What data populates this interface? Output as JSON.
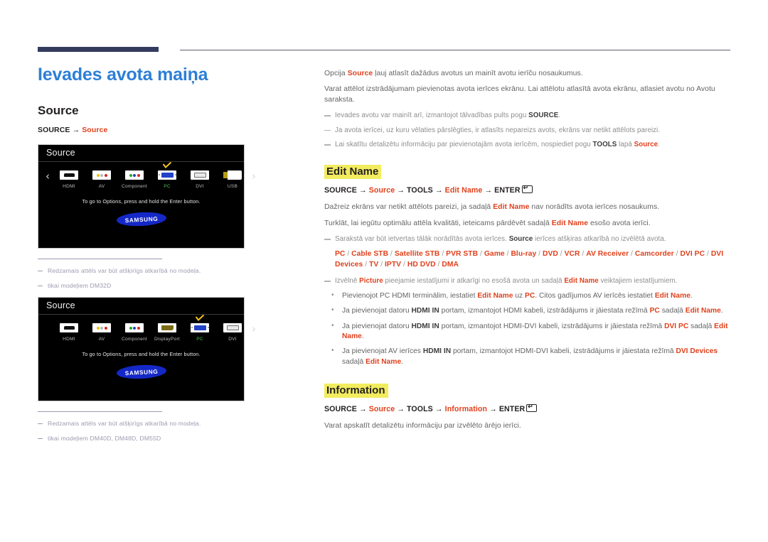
{
  "document": {
    "page_title": "Ievades avota maiņa",
    "accent_color": "#e0401c",
    "title_color": "#2d7fd6",
    "highlight_color": "#f2ec5e",
    "rule_color": "#333b5e"
  },
  "left": {
    "section_title": "Source",
    "path": {
      "source": "SOURCE",
      "arrow": "→",
      "target": "Source"
    },
    "panels": [
      {
        "header": "Source",
        "prev_arrow": "‹",
        "next_arrow": "›",
        "hint": "To go to Options, press and hold the Enter button.",
        "brand": "SAMSUNG",
        "items": [
          {
            "label": "HDMI",
            "icon": "hdmi-port-icon",
            "selected": false
          },
          {
            "label": "AV",
            "icon": "av-rca-icon",
            "selected": false
          },
          {
            "label": "Component",
            "icon": "component-rca-icon",
            "selected": false
          },
          {
            "label": "PC",
            "icon": "dsub-vga-icon",
            "selected": true
          },
          {
            "label": "DVI",
            "icon": "dvi-port-icon",
            "selected": false
          },
          {
            "label": "USB",
            "icon": "usb-stick-icon",
            "selected": false
          }
        ],
        "footnotes": [
          "Redzamais attēls var būt atšķirīgs atkarībā no modeļa.",
          "tikai modeļiem DM32D"
        ]
      },
      {
        "header": "Source",
        "prev_arrow": "",
        "next_arrow": "›",
        "hint": "To go to Options, press and hold the Enter button.",
        "brand": "SAMSUNG",
        "items": [
          {
            "label": "HDMI",
            "icon": "hdmi-port-icon",
            "selected": false
          },
          {
            "label": "AV",
            "icon": "av-rca-icon",
            "selected": false
          },
          {
            "label": "Component",
            "icon": "component-rca-icon",
            "selected": false
          },
          {
            "label": "DisplayPort",
            "icon": "displayport-icon",
            "selected": false
          },
          {
            "label": "PC",
            "icon": "dsub-vga-icon",
            "selected": true
          },
          {
            "label": "DVI",
            "icon": "dvi-port-icon",
            "selected": false
          }
        ],
        "footnotes": [
          "Redzamais attēls var būt atšķirīgs atkarībā no modeļa.",
          "tikai modeļiem DM40D, DM48D, DM55D"
        ]
      }
    ]
  },
  "right": {
    "intro": {
      "p1_a": "Opcija ",
      "p1_source": "Source",
      "p1_b": " ļauj atlasīt dažādus avotus un mainīt avotu ierīču nosaukumus.",
      "p2": "Varat attēlot izstrādājumam pievienotas avota ierīces ekrānu. Lai attēlotu atlasītā avota ekrānu, atlasiet avotu no Avotu saraksta.",
      "note1_a": "Ievades avotu var mainīt arī, izmantojot tālvadības pults pogu ",
      "note1_b": "SOURCE",
      "note1_c": ".",
      "note2": "Ja avota ierīcei, uz kuru vēlaties pārslēgties, ir atlasīts nepareizs avots, ekrāns var netikt attēlots pareizi.",
      "note3_a": "Lai skatītu detalizētu informāciju par pievienotajām avota ierīcēm, nospiediet pogu ",
      "note3_b": "TOOLS",
      "note3_c": " lapā ",
      "note3_d": "Source",
      "note3_e": "."
    },
    "edit_name": {
      "heading": "Edit Name",
      "path": {
        "p1": "SOURCE",
        "p2": "Source",
        "p3": "TOOLS",
        "p4": "Edit Name",
        "p5": "ENTER",
        "arrow": "→"
      },
      "p1_a": "Dažreiz ekrāns var netikt attēlots pareizi, ja sadaļā ",
      "p1_b": "Edit Name",
      "p1_c": " nav norādīts avota ierīces nosaukums.",
      "p2_a": "Turklāt, lai iegūtu optimālu attēla kvalitāti, ieteicams pārdēvēt sadaļā ",
      "p2_b": "Edit Name",
      "p2_c": " esošo avota ierīci.",
      "note_list_a": "Sarakstā var būt ietvertas tālāk norādītās avota ierīces. ",
      "note_list_b": "Source",
      "note_list_c": " ierīces atšķiras atkarībā no izvēlētā avota.",
      "device_list": [
        "PC",
        "Cable STB",
        "Satellite STB",
        "PVR STB",
        "Game",
        "Blu-ray",
        "DVD",
        "VCR",
        "AV Receiver",
        "Camcorder",
        "DVI PC",
        "DVI Devices",
        "TV",
        "IPTV",
        "HD DVD",
        "DMA"
      ],
      "note_picture_a": "Izvēlnē ",
      "note_picture_b": "Picture",
      "note_picture_c": " pieejamie iestatījumi ir atkarīgi no esošā avota un sadaļā ",
      "note_picture_d": "Edit Name",
      "note_picture_e": " veiktajiem iestatījumiem.",
      "bullets": [
        {
          "t1": "Pievienojot PC HDMI terminālim, iestatiet ",
          "b1": "Edit Name",
          "t2": " uz ",
          "b2": "PC",
          "t3": ". Citos gadījumos AV ierīcēs iestatiet ",
          "b3": "Edit Name",
          "t4": "."
        },
        {
          "t1": "Ja pievienojat datoru ",
          "b1": "HDMI IN",
          "t2": " portam, izmantojot HDMI kabeli, izstrādājums ir jāiestata režīmā ",
          "b2": "PC",
          "t3": " sadaļā ",
          "b3": "Edit Name",
          "t4": "."
        },
        {
          "t1": "Ja pievienojat datoru ",
          "b1": "HDMI IN",
          "t2": "  portam, izmantojot HDMI-DVI kabeli, izstrādājums ir jāiestata režīmā ",
          "b2": "DVI PC",
          "t3": " sadaļā ",
          "b3": "Edit Name",
          "t4": "."
        },
        {
          "t1": "Ja pievienojat AV ierīces ",
          "b1": "HDMI IN",
          "t2": "  portam, izmantojot HDMI-DVI kabeli, izstrādājums ir jāiestata režīmā ",
          "b2": "DVI Devices",
          "t3": " sadaļā ",
          "b3": "Edit Name",
          "t4": "."
        }
      ]
    },
    "information": {
      "heading": "Information",
      "path": {
        "p1": "SOURCE",
        "p2": "Source",
        "p3": "TOOLS",
        "p4": "Information",
        "p5": "ENTER",
        "arrow": "→"
      },
      "body": "Varat apskatīt detalizētu informāciju par izvēlēto ārējo ierīci."
    }
  }
}
